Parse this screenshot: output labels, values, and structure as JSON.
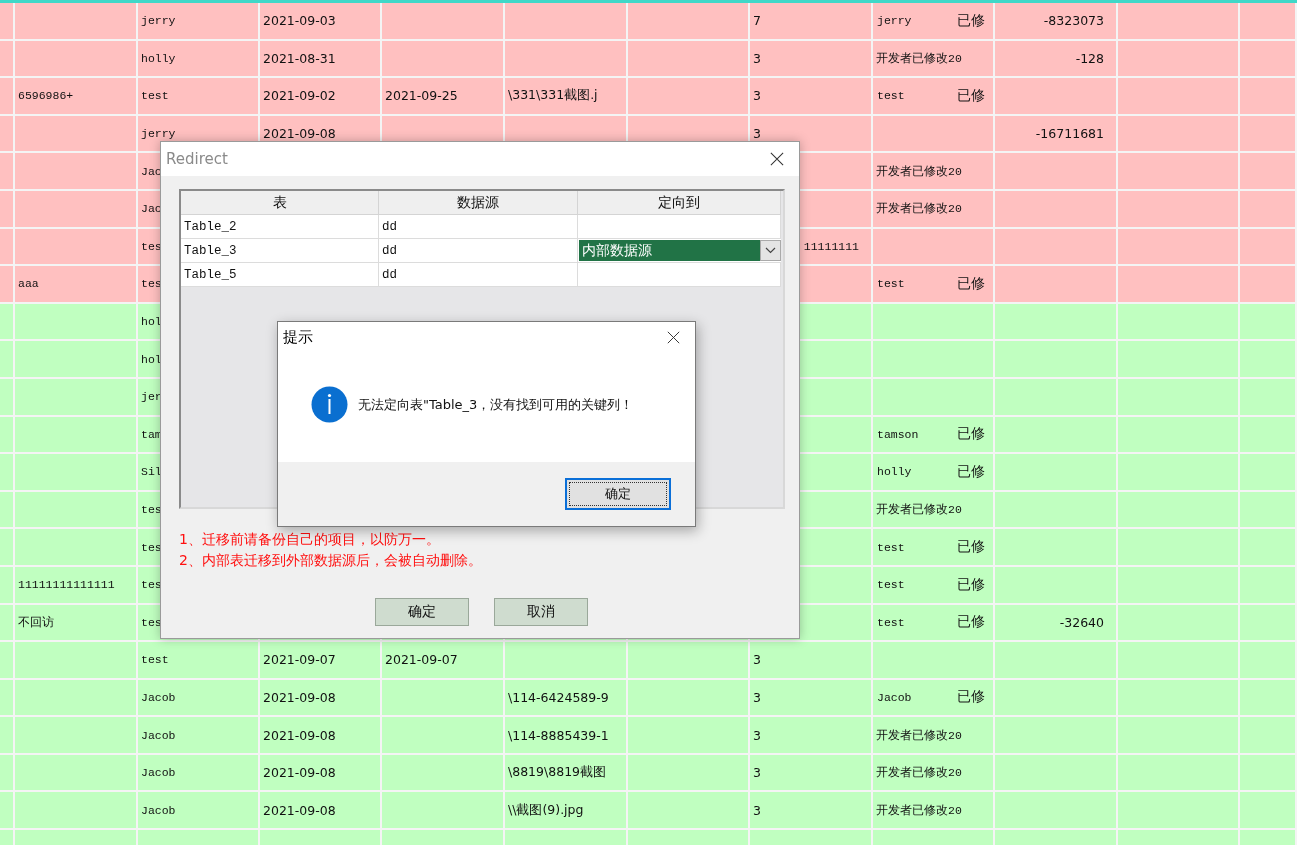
{
  "table": {
    "rows": [
      {
        "color": "#ffc0c0",
        "cells": [
          null,
          null,
          "jerry",
          "2021-09-03",
          null,
          null,
          null,
          "7",
          {
            "parts": [
              "jerry",
              "已修"
            ]
          },
          "-8323073",
          null,
          null
        ]
      },
      {
        "color": "#ffc0c0",
        "cells": [
          null,
          null,
          "holly",
          "2021-08-31",
          null,
          null,
          null,
          "3",
          "开发者已修改20",
          "-128",
          null,
          null
        ]
      },
      {
        "color": "#ffc0c0",
        "cells": [
          null,
          "6596986+",
          "test",
          "2021-09-02",
          "2021-09-25",
          "\\331\\331截图.j",
          null,
          "3",
          {
            "parts": [
              "test",
              "已修"
            ]
          },
          null,
          null,
          null
        ]
      },
      {
        "color": "#ffc0c0",
        "cells": [
          null,
          null,
          "jerry",
          "2021-09-08",
          null,
          null,
          null,
          "3",
          null,
          "-16711681",
          null,
          null
        ]
      },
      {
        "color": "#ffc0c0",
        "cells": [
          null,
          null,
          "Jac",
          null,
          null,
          null,
          null,
          null,
          "开发者已修改20",
          null,
          null,
          null
        ]
      },
      {
        "color": "#ffc0c0",
        "cells": [
          null,
          null,
          "Jac",
          null,
          null,
          null,
          null,
          null,
          "开发者已修改20",
          null,
          null,
          null
        ]
      },
      {
        "color": "#ffc0c0",
        "cells": [
          null,
          null,
          "tes",
          null,
          null,
          null,
          null,
          {
            "text": "11111111",
            "kind": "clipped"
          },
          null,
          null,
          null,
          null
        ]
      },
      {
        "color": "#ffc0c0",
        "cells": [
          null,
          "aaa",
          "tes",
          null,
          null,
          null,
          null,
          null,
          {
            "parts": [
              "test",
              "已修"
            ]
          },
          null,
          null,
          null
        ]
      },
      {
        "color": "#c0ffc0",
        "cells": [
          null,
          null,
          "hol",
          null,
          null,
          null,
          null,
          null,
          null,
          null,
          null,
          null
        ]
      },
      {
        "color": "#c0ffc0",
        "cells": [
          null,
          null,
          "hol",
          null,
          null,
          null,
          null,
          null,
          null,
          null,
          null,
          null
        ]
      },
      {
        "color": "#c0ffc0",
        "cells": [
          null,
          null,
          "jer",
          null,
          null,
          null,
          null,
          null,
          null,
          null,
          null,
          null
        ]
      },
      {
        "color": "#c0ffc0",
        "cells": [
          null,
          null,
          "tam",
          null,
          null,
          null,
          null,
          null,
          {
            "parts": [
              "tamson",
              "已修"
            ]
          },
          null,
          null,
          null
        ]
      },
      {
        "color": "#c0ffc0",
        "cells": [
          null,
          null,
          "Sil",
          null,
          null,
          null,
          null,
          null,
          {
            "parts": [
              "holly",
              "已修"
            ]
          },
          null,
          null,
          null
        ]
      },
      {
        "color": "#c0ffc0",
        "cells": [
          null,
          null,
          "tes",
          null,
          null,
          null,
          null,
          null,
          "开发者已修改20",
          null,
          null,
          null
        ]
      },
      {
        "color": "#c0ffc0",
        "cells": [
          null,
          null,
          "tes",
          null,
          null,
          null,
          null,
          null,
          {
            "parts": [
              "test",
              "已修"
            ]
          },
          null,
          null,
          null
        ]
      },
      {
        "color": "#c0ffc0",
        "cells": [
          null,
          "11111111111111",
          "tes",
          null,
          null,
          null,
          null,
          null,
          {
            "parts": [
              "test",
              "已修"
            ]
          },
          null,
          null,
          null
        ]
      },
      {
        "color": "#c0ffc0",
        "cells": [
          null,
          "不回访",
          "tes",
          null,
          null,
          null,
          null,
          null,
          {
            "parts": [
              "test",
              "已修"
            ]
          },
          "-32640",
          null,
          null
        ]
      },
      {
        "color": "#c0ffc0",
        "cells": [
          null,
          null,
          "test",
          "2021-09-07",
          "2021-09-07",
          null,
          null,
          "3",
          null,
          null,
          null,
          null
        ]
      },
      {
        "color": "#c0ffc0",
        "cells": [
          null,
          null,
          "Jacob",
          "2021-09-08",
          null,
          "\\114-6424589-9",
          null,
          "3",
          {
            "parts": [
              "Jacob",
              "已修"
            ]
          },
          null,
          null,
          null
        ]
      },
      {
        "color": "#c0ffc0",
        "cells": [
          null,
          null,
          "Jacob",
          "2021-09-08",
          null,
          "\\114-8885439-1",
          null,
          "3",
          "开发者已修改20",
          null,
          null,
          null
        ]
      },
      {
        "color": "#c0ffc0",
        "cells": [
          null,
          null,
          "Jacob",
          "2021-09-08",
          null,
          "\\8819\\8819截图",
          null,
          "3",
          "开发者已修改20",
          null,
          null,
          null
        ]
      },
      {
        "color": "#c0ffc0",
        "cells": [
          null,
          null,
          "Jacob",
          "2021-09-08",
          null,
          "\\\\截图(9).jpg",
          null,
          "3",
          "开发者已修改20",
          null,
          null,
          null
        ]
      },
      {
        "color": "#c0ffc0",
        "cells": [
          null,
          null,
          null,
          null,
          null,
          null,
          null,
          null,
          null,
          null,
          null,
          null
        ]
      }
    ]
  },
  "redirect_dialog": {
    "title": "Redirect",
    "columns": [
      "表",
      "数据源",
      "定向到"
    ],
    "rows": [
      {
        "table": "Table_2",
        "source": "dd",
        "selected": false
      },
      {
        "table": "Table_3",
        "source": "dd",
        "selected": true,
        "target": "内部数据源"
      },
      {
        "table": "Table_5",
        "source": "dd",
        "selected": false
      }
    ],
    "notes": [
      "1、迁移前请备份自己的项目，以防万一。",
      "2、内部表迁移到外部数据源后，会被自动删除。"
    ],
    "buttons": [
      "确定",
      "取消"
    ]
  },
  "message_box": {
    "title": "提示",
    "message": "无法定向表\"Table_3，没有找到可用的关键列！",
    "button": "确定"
  }
}
